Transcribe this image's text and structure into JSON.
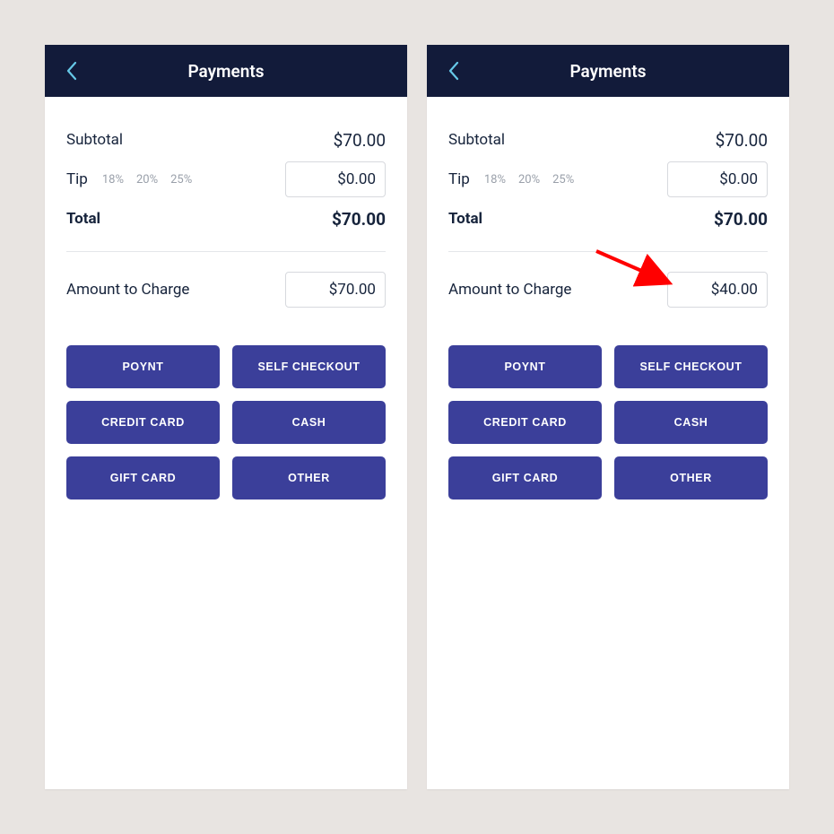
{
  "screens": [
    {
      "header": {
        "title": "Payments"
      },
      "subtotal": {
        "label": "Subtotal",
        "value": "$70.00"
      },
      "tip": {
        "label": "Tip",
        "options": [
          "18%",
          "20%",
          "25%"
        ],
        "input_value": "$0.00"
      },
      "total": {
        "label": "Total",
        "value": "$70.00"
      },
      "charge": {
        "label": "Amount to Charge",
        "input_value": "$70.00"
      },
      "buttons": [
        "POYNT",
        "SELF CHECKOUT",
        "CREDIT CARD",
        "CASH",
        "GIFT CARD",
        "OTHER"
      ]
    },
    {
      "header": {
        "title": "Payments"
      },
      "subtotal": {
        "label": "Subtotal",
        "value": "$70.00"
      },
      "tip": {
        "label": "Tip",
        "options": [
          "18%",
          "20%",
          "25%"
        ],
        "input_value": "$0.00"
      },
      "total": {
        "label": "Total",
        "value": "$70.00"
      },
      "charge": {
        "label": "Amount to Charge",
        "input_value": "$40.00"
      },
      "buttons": [
        "POYNT",
        "SELF CHECKOUT",
        "CREDIT CARD",
        "CASH",
        "GIFT CARD",
        "OTHER"
      ]
    }
  ],
  "annotation": {
    "arrow_color": "#ff0000"
  }
}
